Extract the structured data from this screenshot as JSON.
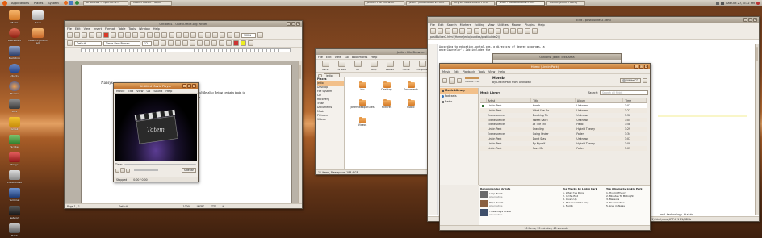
{
  "panel": {
    "menus": [
      "Applications",
      "Places",
      "System"
    ],
    "tasks": [
      "Untitled1 - OpenOffic...",
      "Totem Movie Player",
      "Jedio - File Browser",
      "jEdit - postBuilder2.html",
      "Rhythmbox Linkin Park",
      "jEdit - postBuilder2.html",
      "Homb (Linkin Park)"
    ],
    "clock": "Sat Oct 27,  3:32 PM"
  },
  "desktop": {
    "icons": [
      "Media",
      "Dashboard",
      "Backdrop",
      "Ubuntu",
      "Firefox",
      "Lock",
      "Gmail",
      "Scribe",
      "Fridge",
      "Preferences",
      "Terminal",
      "Network",
      "Trash"
    ],
    "icons_right": [
      "Trash",
      "network-jboard-jack"
    ]
  },
  "writer": {
    "title": "Untitled1 - OpenOffice.org Writer",
    "menus": [
      "File",
      "Edit",
      "View",
      "Insert",
      "Format",
      "Table",
      "Tools",
      "Window",
      "Help"
    ],
    "style": "Default",
    "font": "Times New Roman",
    "size": "12",
    "zoom": "100%",
    "doc_line1": "Nansys",
    "doc_line2": "while also being certain train to",
    "doc_line3": "e",
    "status": [
      "Page 1 / 1",
      "Default",
      "100%",
      "INSRT",
      "STD",
      "*"
    ]
  },
  "totem": {
    "title": "Untitled Movie Player",
    "menus": [
      "Movie",
      "Edit",
      "View",
      "Go",
      "Sound",
      "Help"
    ],
    "logo_text": "Totem",
    "time_label": "Time:",
    "sidebar_button": "Sidebar",
    "status": "Stopped",
    "timecode": "0:00 / 0:00"
  },
  "files": {
    "title": "Jedio - File Browser",
    "menus": [
      "File",
      "Edit",
      "View",
      "Go",
      "Bookmarks",
      "Help"
    ],
    "toolbar": [
      "Back",
      "Forward",
      "Up",
      "Stop",
      "Reload",
      "Home",
      "Computer",
      "Search"
    ],
    "location": "jedio",
    "zoom": "100%",
    "view_mode": "View as Icons",
    "side_header": "Places",
    "places": [
      "Jedio",
      "Desktop",
      "File System",
      "CD",
      "Recovery",
      "Trash",
      "Documents",
      "Music",
      "Pictures",
      "Videos"
    ],
    "folders": [
      "bin",
      "Desktop",
      "Documents",
      "examples",
      "jbservwebpictures",
      "Pictures",
      "Public",
      "Templates",
      "Videos"
    ],
    "status": "11 items, Free space: 183.4 GB"
  },
  "jedit": {
    "title": "jEdit - postBuilder2.html",
    "menus": [
      "File",
      "Edit",
      "Search",
      "Markers",
      "Folding",
      "View",
      "Utilities",
      "Macros",
      "Plugins",
      "Help"
    ],
    "path": "postBuilder2.html (Home/jedio/buddies/postBuilder2/)",
    "lines": [
      "According to education-portal.com, a directory of degree programs, a",
      "ance Counselor's Job includes the"
    ],
    "right_snip": "and technology fields",
    "status": "(1,1)    html,none,UTF-8 1 61/68Mb",
    "dialog_title": "Options: jEdit: Text Area"
  },
  "rhythm": {
    "title": "Homb (Linkin Park)",
    "menus": [
      "Music",
      "Edit",
      "Playback",
      "Tools",
      "View",
      "Help"
    ],
    "now_title": "Homb",
    "now_by": "by Linkin Park  from Unknown",
    "time": "1:08 of 3:38",
    "write_cd": "Write CD",
    "side": [
      "Music Library",
      "Podcasts",
      "Radio"
    ],
    "search_label": "Search:",
    "search_placeholder": "Search all fields",
    "columns": [
      "",
      "Artist",
      "Title",
      "Album",
      "Time"
    ],
    "rows": [
      [
        "Linkin Park",
        "Homb",
        "Unknown",
        "3:07"
      ],
      [
        "Linkin Park",
        "What I've Do",
        "Unknown",
        "3:27"
      ],
      [
        "Evanescence",
        "Breaking Th",
        "Unknown",
        "3:36"
      ],
      [
        "Evanescence",
        "Sweet Sacri",
        "Unknown",
        "3:04"
      ],
      [
        "Evanescence",
        "At The End",
        "Hello",
        "3:58"
      ],
      [
        "Linkin Park",
        "Crawling",
        "Hybrid Theory",
        "3:29"
      ],
      [
        "Evanescence",
        "Going Under",
        "Fallen",
        "3:34"
      ],
      [
        "Linkin Park",
        "Don't Stay",
        "Unknown",
        "3:07"
      ],
      [
        "Linkin Park",
        "By Myself",
        "Hybrid Theory",
        "3:09"
      ],
      [
        "Linkin Park",
        "Save Me",
        "Fallen",
        "3:01"
      ]
    ],
    "rec_header": "Recommended Artists",
    "rec": [
      {
        "name": "Limp Bizkit",
        "sub": "Alternative"
      },
      {
        "name": "Papa Roach",
        "sub": "Alternative"
      },
      {
        "name": "Three Days Grace",
        "sub": "Alternative"
      }
    ],
    "tracks_header": "Top Tracks by Linkin Park",
    "tracks": [
      "1. What I've Done",
      "2. In the End",
      "3. Given Up",
      "4. Shadow of the Day",
      "5. Numb"
    ],
    "albums_header": "Top Albums by Linkin Park",
    "albums": [
      "1. Hybrid Theory",
      "2. Minutes To Midnight",
      "3. Meteora",
      "4. Reanimation",
      "5. Live in Texas"
    ],
    "status": "10 items, 35 minutes, 40 seconds"
  },
  "colors": {
    "accent": "#c0702c",
    "wallpaper": "#8a4b22",
    "selection": "#f2c08a"
  }
}
